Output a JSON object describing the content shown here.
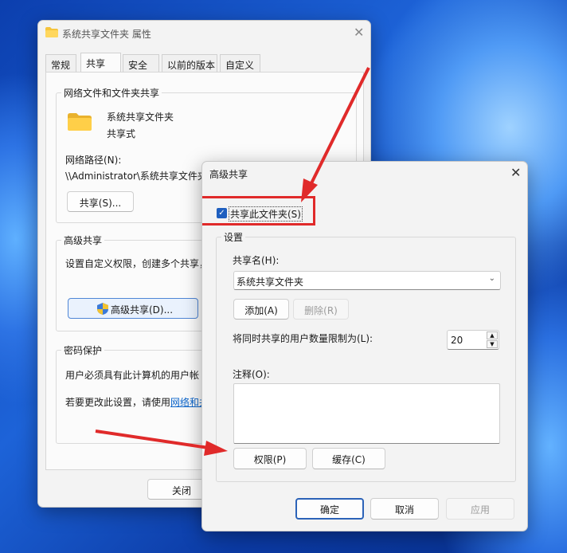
{
  "properties_window": {
    "title": "系统共享文件夹 属性",
    "tabs": [
      {
        "label": "常规"
      },
      {
        "label": "共享"
      },
      {
        "label": "安全"
      },
      {
        "label": "以前的版本"
      },
      {
        "label": "自定义"
      }
    ],
    "network_group": {
      "title": "网络文件和文件夹共享",
      "folder_name": "系统共享文件夹",
      "share_status": "共享式",
      "path_label": "网络路径(N):",
      "path_value": "\\\\Administrator\\系统共享文件夹",
      "share_button": "共享(S)..."
    },
    "advanced_group": {
      "title": "高级共享",
      "description": "设置自定义权限，创建多个共享，",
      "button": "高级共享(D)..."
    },
    "password_group": {
      "title": "密码保护",
      "description": "用户必须具有此计算机的用户帐",
      "change_prefix": "若要更改此设置，请使用",
      "change_link": "网络和共"
    },
    "close_button": "关闭"
  },
  "advanced_dialog": {
    "title": "高级共享",
    "share_checkbox": {
      "label": "共享此文件夹(S)",
      "checked": true
    },
    "settings_group": {
      "title": "设置",
      "share_name_label": "共享名(H):",
      "share_name_value": "系统共享文件夹",
      "add_button": "添加(A)",
      "remove_button": "删除(R)",
      "user_limit_label": "将同时共享的用户数量限制为(L):",
      "user_limit_value": "20",
      "comment_label": "注释(O):",
      "comment_value": "",
      "permissions_button": "权限(P)",
      "caching_button": "缓存(C)"
    },
    "ok_button": "确定",
    "cancel_button": "取消",
    "apply_button": "应用"
  },
  "colors": {
    "highlight": "#e02a2a",
    "accent": "#2c63b8",
    "folder": "#f5c43c"
  }
}
